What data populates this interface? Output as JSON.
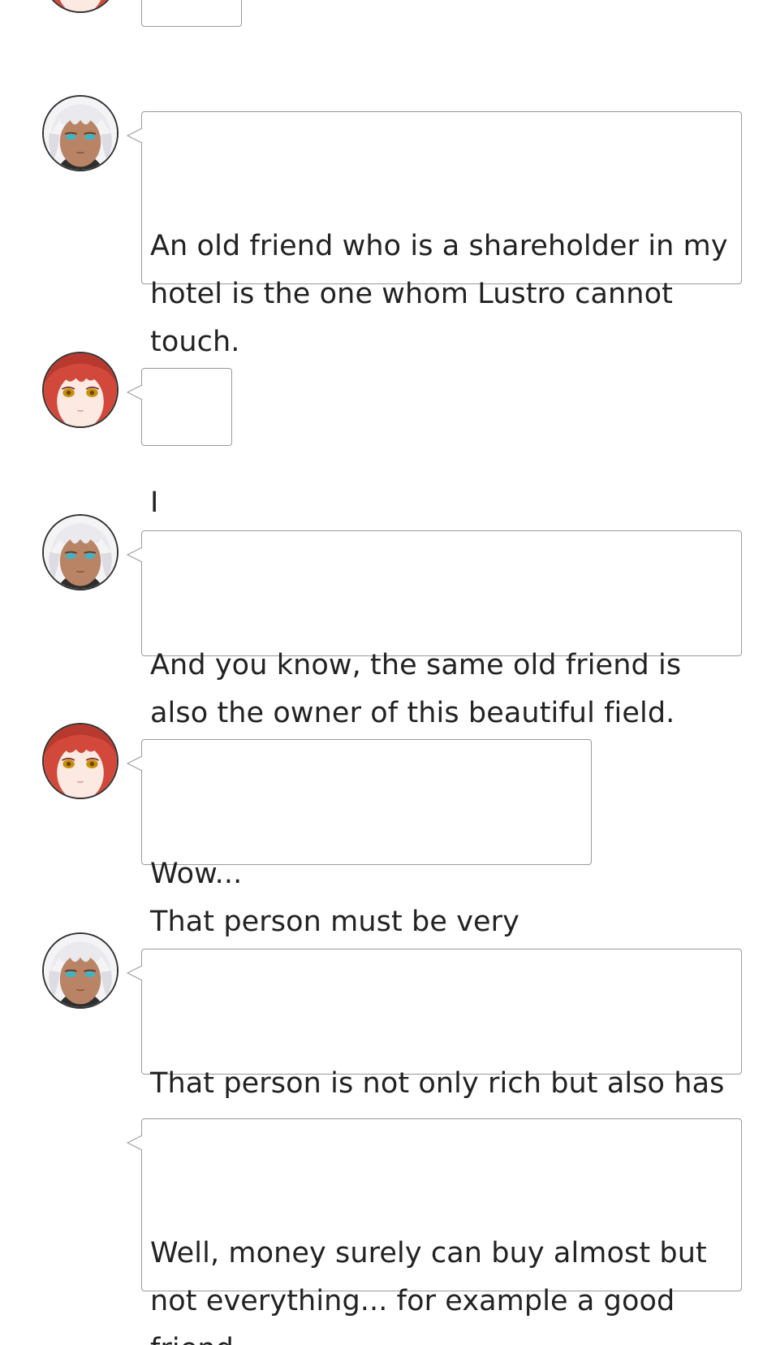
{
  "chat": {
    "messages": [
      {
        "speaker": "red-haired-girl",
        "text": ""
      },
      {
        "speaker": "white-haired-man",
        "text": "An old friend who is a shareholder in my hotel is the one whom Lustro cannot touch."
      },
      {
        "speaker": "red-haired-girl",
        "text": "I see."
      },
      {
        "speaker": "white-haired-man",
        "text": "And you know, the same old friend is also the owner of this beautiful field."
      },
      {
        "speaker": "red-haired-girl",
        "text": "Wow...\nThat person must be very rich."
      },
      {
        "speaker": "white-haired-man",
        "text": "That person is not only rich but also has a good vision."
      },
      {
        "speaker": "white-haired-man",
        "text": "Well, money surely can buy almost but not everything... for example a good friend."
      }
    ]
  },
  "colors": {
    "bubble_border": "#9a9a9a",
    "text": "#222222",
    "red_hair": "#d2483a",
    "white_hair": "#e9e9ee",
    "eye_teal": "#3fb4c4",
    "eye_amber": "#c8900a"
  },
  "icons": {
    "girl_avatar": "red-haired-girl-avatar-icon",
    "man_avatar": "white-haired-man-avatar-icon"
  }
}
